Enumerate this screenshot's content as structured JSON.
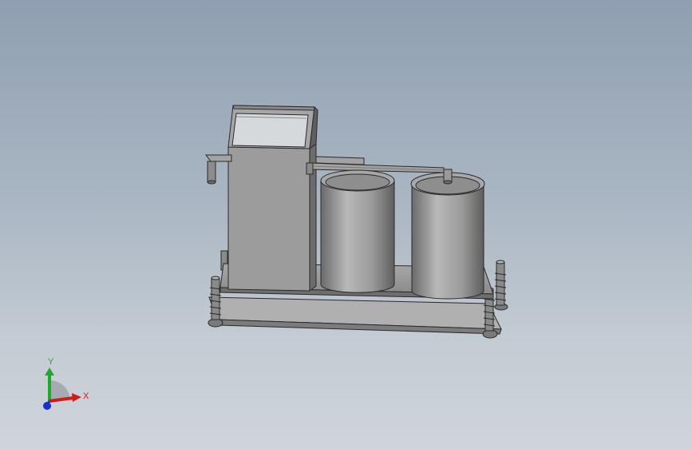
{
  "viewport": {
    "background_top": "#8f9fb1",
    "background_bottom": "#cfd5da"
  },
  "model": {
    "body_color": "#9a9a9a",
    "dark_color": "#6e6e6e",
    "light_color": "#c4c4c4",
    "edge_color": "#2a2a2a",
    "screen_color": "#d6d9dc"
  },
  "triad": {
    "x_label": "X",
    "y_label": "Y",
    "x_color": "#d11a1a",
    "y_color": "#1fa82a",
    "z_color": "#1a2fd1"
  }
}
